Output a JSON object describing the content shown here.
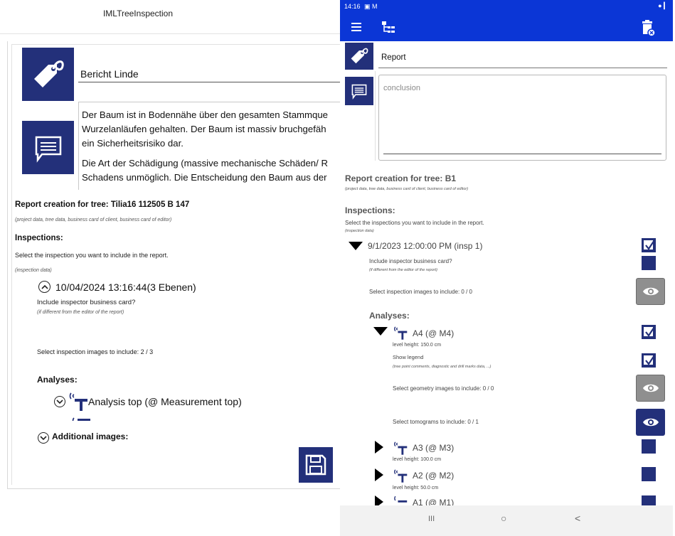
{
  "desktop": {
    "window_title": "IMLTreeInspection",
    "report_title": "Bericht Linde",
    "conclusion_paragraphs": [
      [
        "Der Baum ist in Bodennähe über den gesamten Stammque",
        "Wurzelanläufen gehalten. Der Baum ist massiv bruchgefäh",
        "ein Sicherheitsrisiko dar."
      ],
      [
        "Die Art der Schädigung (massive mechanische Schäden/ R",
        "Schadens unmöglich. Die Entscheidung den Baum aus der"
      ]
    ],
    "report_creation_heading": "Report creation for tree: Tilia16 112505 B 147",
    "report_creation_note": "(project data, tree data, business card of client, business card of editor)",
    "inspections_heading": "Inspections:",
    "inspections_instruction": "Select the inspection you want to include in the report.",
    "inspections_note": "(inspection data)",
    "inspection_date": "10/04/2024 13:16:44(3 Ebenen)",
    "include_business_card": "Include inspector business card?",
    "business_card_note": "(if different from the editor of the report)",
    "select_images": "Select inspection images to include: 2 / 3",
    "analyses_heading": "Analyses:",
    "analysis_1": "Analysis top (@ Measurement top)",
    "additional_images": "Additional images:"
  },
  "phone": {
    "status_time": "14:16",
    "status_icons_left": "▣ M",
    "status_icons_right": "● ▎",
    "report_title": "Report",
    "conclusion_placeholder": "conclusion",
    "report_creation_heading": "Report creation for tree: B1",
    "report_creation_note": "(project data, tree data, business card of client, business card of editor)",
    "inspections_heading": "Inspections:",
    "inspections_instruction": "Select the inspections you want to include in the report.",
    "inspections_note": "(inspection data)",
    "inspection_date": "9/1/2023 12:00:00 PM (insp 1)",
    "include_business_card": "Include inspector business card?",
    "business_card_note": "(if different from the editor of the report)",
    "select_images": "Select inspection images to include: 0 / 0",
    "analyses_heading": "Analyses:",
    "analyses": [
      {
        "label": "A4 (@ M4)",
        "level": "level height: 150.0 cm",
        "checked": true
      },
      {
        "label": "A3 (@ M3)",
        "level": "level height: 100.0 cm",
        "checked": false
      },
      {
        "label": "A2 (@ M2)",
        "level": "level height: 50.0 cm",
        "checked": false
      },
      {
        "label": "A1 (@ M1)",
        "level": "",
        "checked": false
      }
    ],
    "show_legend": "Show legend",
    "legend_note": "(tree point comments, diagnostic and drill marks data, ...)",
    "select_geometry_images": "Select geometry images to include: 0 / 0",
    "select_tomograms": "Select tomograms to include: 0 / 1",
    "nav": {
      "recents": "III",
      "home": "○",
      "back": "<"
    }
  },
  "colors": {
    "app_blue": "#0b36d6",
    "tile_navy": "#23307a",
    "eye_grey": "#8f8f8f"
  }
}
